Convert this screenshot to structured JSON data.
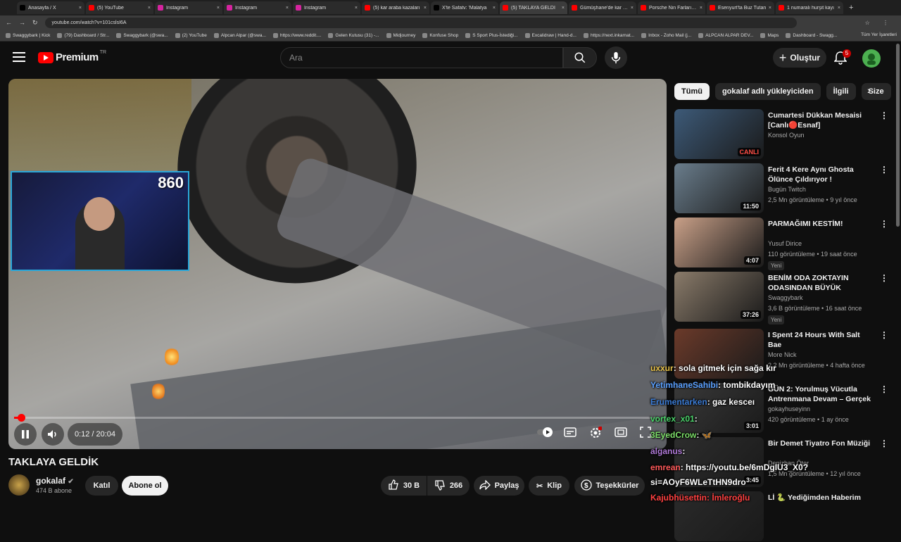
{
  "browser": {
    "tabs": [
      {
        "title": "Anasayfa / X",
        "color": "#000000"
      },
      {
        "title": "(5) YouTube",
        "color": "#ff0000"
      },
      {
        "title": "Instagram",
        "color": "#d6249f"
      },
      {
        "title": "Instagram",
        "color": "#d6249f"
      },
      {
        "title": "Instagram",
        "color": "#d6249f"
      },
      {
        "title": "(5) kar araba kazaları",
        "color": "#ff0000"
      },
      {
        "title": "X'te Safatv: 'Malatya",
        "color": "#000000"
      },
      {
        "title": "(5) TAKLAYA GELDİ",
        "color": "#ff0000"
      },
      {
        "title": "Gümüşhane'de kar yağ",
        "color": "#ff0000"
      },
      {
        "title": "Porsche Nin Farları Na",
        "color": "#ff0000"
      },
      {
        "title": "Esenyurt'ta Buz Tutan",
        "color": "#ff0000"
      },
      {
        "title": "1 numaralı hurşit kayı",
        "color": "#ff0000"
      }
    ],
    "url": "youtube.com/watch?v=101cslsI6A",
    "bookmarks": [
      "Swaggybark | Kick",
      "(79) Dashboard / Str...",
      "Swaggybark (@swa...",
      "(2) YouTube",
      "Alpcan Alpar (@swa...",
      "https://www.reddit....",
      "Gelen Kutusu (31) -...",
      "Midjourney",
      "Konfuse Shop",
      "S Sport Plus-İstediği...",
      "Excalidraw | Hand-d...",
      "https://next.inkarnat...",
      "Inbox - Zoho Mail (j...",
      "ALPCAN ALPAR DEV...",
      "Maps",
      "Dashboard - Swagg..."
    ],
    "bookmarks_right": "Tüm Yer İşaretleri"
  },
  "header": {
    "brand": "Premium",
    "country": "TR",
    "search_placeholder": "Ara",
    "create_label": "Oluştur",
    "notif_count": "5"
  },
  "player": {
    "overlay_counter": "860",
    "time": "0:12 / 20:04",
    "progress_fraction": 0.01
  },
  "video": {
    "title": "TAKLAYA GELDİK",
    "channel": "gokalaf",
    "subscribers": "474 B abone",
    "join_label": "Katıl",
    "subscribe_label": "Abone ol",
    "likes": "30 B",
    "dislikes": "266",
    "share_label": "Paylaş",
    "clip_label": "Klip",
    "thanks_label": "Teşekkürler"
  },
  "sidebar": {
    "chips": [
      "Tümü",
      "gokalaf adlı yükleyiciden",
      "İlgili",
      "Size"
    ],
    "items": [
      {
        "title": "Cumartesi Dükkan Mesaisi [Canlı🔴Esnaf]",
        "channel": "Konsol Oyun",
        "meta": "",
        "badge": "CANLI",
        "new": "",
        "thumb": "#3d5a78"
      },
      {
        "title": "Ferit 4 Kere Aynı Ghosta Ölünce Çıldırıyor !",
        "channel": "Bugün Twitch",
        "meta": "2,5 Mn görüntüleme • 9 yıl önce",
        "badge": "11:50",
        "new": "",
        "thumb": "#6a7d8c"
      },
      {
        "title": "PARMAĞIMI KESTİM!",
        "channel": "Yusuf Dirice",
        "meta": "110 görüntüleme • 19 saat önce",
        "badge": "4:07",
        "new": "Yeni",
        "thumb": "#c9a088"
      },
      {
        "title": "BENİM ODA ZOKTAYIN ODASINDAN BÜYÜK",
        "channel": "Swaggybark",
        "meta": "3,6 B görüntüleme • 16 saat önce",
        "badge": "37:26",
        "new": "Yeni",
        "thumb": "#8a7b6a"
      },
      {
        "title": "I Spent 24 Hours With Salt Bae",
        "channel": "More Nick",
        "meta": "2,2 Mn görüntüleme • 4 hafta önce",
        "badge": "",
        "new": "",
        "thumb": "#6b3a2a"
      },
      {
        "title": "GÜN 2: Yorulmuş Vücutla Antrenmana Devam – Gerçek ...",
        "channel": "gokayhuseyinn",
        "meta": "420 görüntüleme • 1 ay önce",
        "badge": "3:01",
        "new": "",
        "thumb": "#3a3a3a"
      },
      {
        "title": "Bir Demet Tiyatro Fon Müziği",
        "channel": "Denizhan Öter",
        "meta": "1,5 Mn görüntüleme • 12 yıl önce",
        "badge": "3:45",
        "new": "",
        "thumb": "#2d2d2d"
      },
      {
        "title": "Lİ 🐍 Yediğimden Haberim",
        "channel": "",
        "meta": "",
        "badge": "",
        "new": "",
        "thumb": "#2a2a2a"
      }
    ]
  },
  "chat": [
    {
      "user": "uxxur",
      "text": ": sola gitmek için sağa kır",
      "color": "#e8c24a"
    },
    {
      "user": "YetimhaneSahibi",
      "text": ": tombikdayım",
      "color": "#5aa0ff"
    },
    {
      "user": "Erumentarken",
      "text": ": gaz kesceı",
      "color": "#3a7bd5"
    },
    {
      "user": "vortex_x01",
      "text": ":",
      "color": "#4ad46a"
    },
    {
      "user": "3EyedCrow",
      "text": ": 🦋",
      "color": "#7ee06a"
    },
    {
      "user": "alganus",
      "text": ":",
      "color": "#b07ad8"
    },
    {
      "user": "emrean",
      "text": ": https://youtu.be/6mDgIU3_X0?",
      "color": "#ff5a5a"
    },
    {
      "user": "",
      "text": "si=AOyF6WLeTtHN9dro",
      "color": "#ffffff"
    },
    {
      "user": "Kajubhüsettin: İmleroğlu",
      "text": "",
      "color": "#ff4040"
    }
  ]
}
